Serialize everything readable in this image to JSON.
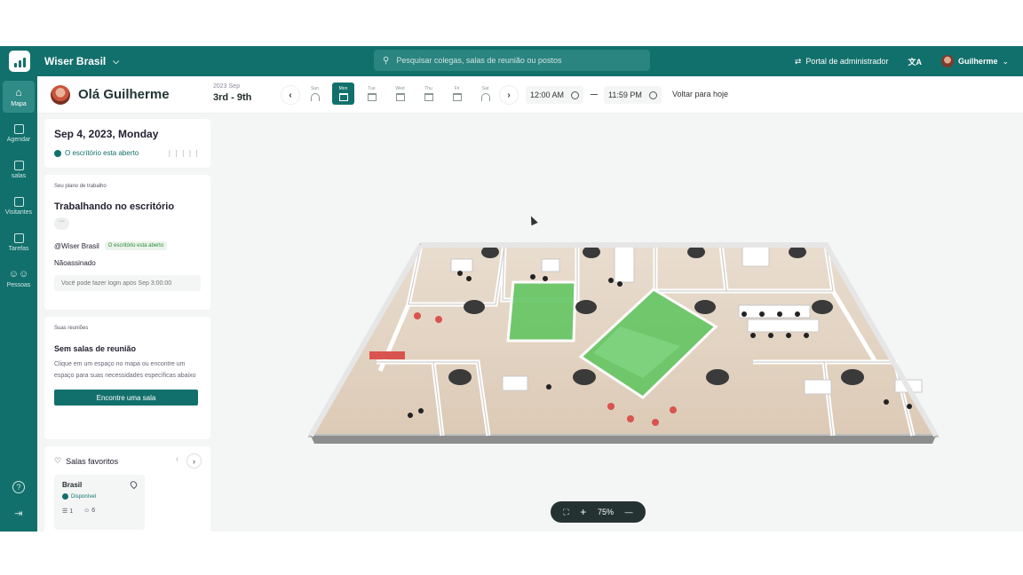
{
  "topbar": {
    "org_name": "Wiser Brasil",
    "search_placeholder": "Pesquisar colegas, salas de reunião ou postos",
    "admin_portal": "Portal de administrador",
    "user_name": "Guilherme"
  },
  "rail": {
    "items": [
      {
        "label": "Mapa",
        "icon": "map-icon"
      },
      {
        "label": "Agendar",
        "icon": "calendar-icon"
      },
      {
        "label": "salas",
        "icon": "room-icon"
      },
      {
        "label": "Visitantes",
        "icon": "visitor-icon"
      },
      {
        "label": "Tarefas",
        "icon": "task-icon"
      },
      {
        "label": "Pessoas",
        "icon": "people-icon"
      }
    ],
    "help": "?",
    "logout": "⇥"
  },
  "header": {
    "greeting": "Olá Guilherme",
    "year_month": "2023 Sep",
    "range": "3rd - 9th",
    "days": [
      {
        "label": "Sun",
        "icon": "beach-umbrella-icon"
      },
      {
        "label": "Mon",
        "icon": "building-icon",
        "selected": true
      },
      {
        "label": "Tue",
        "icon": "building-icon"
      },
      {
        "label": "Wed",
        "icon": "building-icon"
      },
      {
        "label": "Thu",
        "icon": "building-icon"
      },
      {
        "label": "Fri",
        "icon": "building-icon"
      },
      {
        "label": "Sat",
        "icon": "beach-umbrella-icon"
      }
    ],
    "start_time": "12:00 AM",
    "end_time": "11:59 PM",
    "back_today": "Voltar para hoje"
  },
  "day_card": {
    "date": "Sep 4, 2023, Monday",
    "status": "O escritório esta aberto"
  },
  "plan_card": {
    "title": "Seu plano de trabalho",
    "plan": "Trabalhando no escritório",
    "more": "···",
    "office": "@Wiser Brasil",
    "office_status": "O escritório esta aberto",
    "signed": "Nãoassinado",
    "login_placeholder": "Você pode fazer login após Sep 3:00:00"
  },
  "meetings_card": {
    "title": "Suas reuniões",
    "heading": "Sem salas de reunião",
    "desc": "Clique em um espaço no mapa ou encontre um espaço para suas necessidades específicas abaixo",
    "button": "Encontre uma sala"
  },
  "favorites": {
    "title": "Salas favoritos",
    "rooms": [
      {
        "name": "Brasil",
        "status": "Disponível",
        "floors": "1",
        "capacity": "6"
      }
    ]
  },
  "zoom": {
    "level": "75%",
    "plus": "+",
    "minus": "—"
  },
  "colors": {
    "brand": "#12706c",
    "available": "#2f8a3a",
    "room_highlight": "#5cc45c"
  }
}
